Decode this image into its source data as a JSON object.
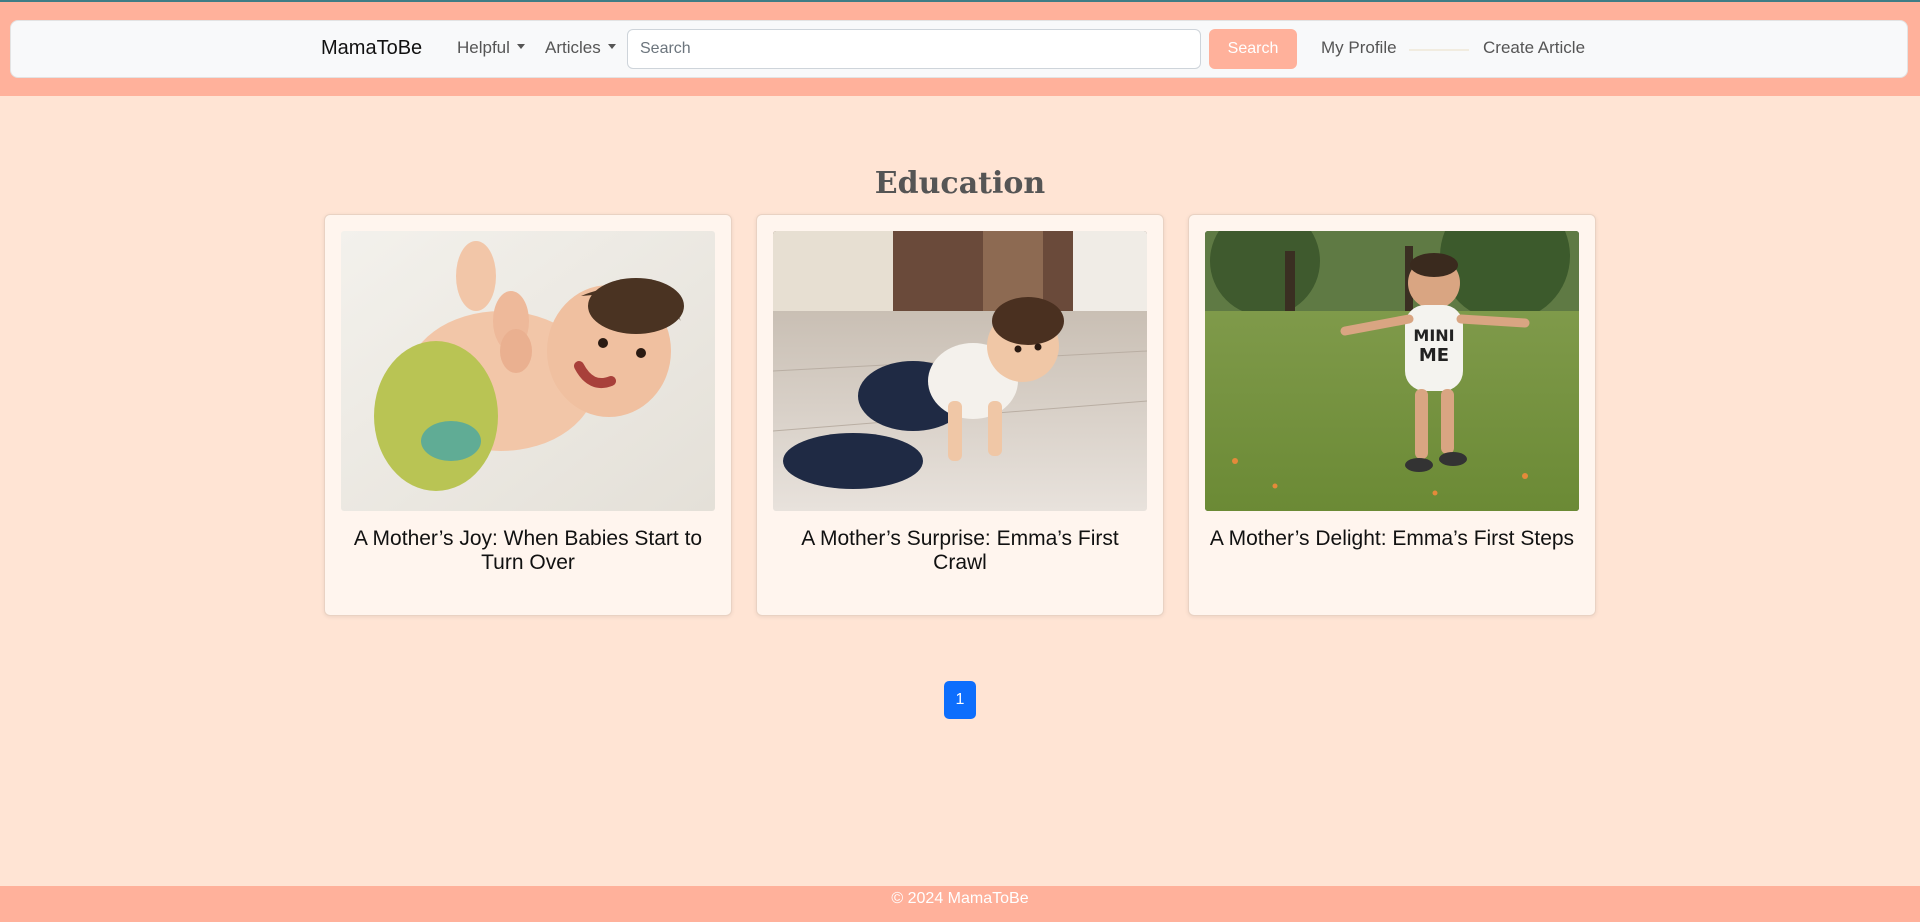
{
  "navbar": {
    "brand": "MamaToBe",
    "helpful_label": "Helpful",
    "articles_label": "Articles",
    "search_placeholder": "Search",
    "search_button": "Search",
    "profile_link": "My Profile",
    "create_link": "Create Article"
  },
  "section": {
    "title": "Education"
  },
  "cards": [
    {
      "title": "A Mother’s Joy: When Babies Start to Turn Over",
      "image": "baby-lying-on-blanket"
    },
    {
      "title": "A Mother’s Surprise: Emma’s First Crawl",
      "image": "baby-crawling-on-floor"
    },
    {
      "title": "A Mother’s Delight: Emma’s First Steps",
      "image": "toddler-walking-in-park"
    }
  ],
  "pagination": {
    "current_page": "1"
  },
  "footer": {
    "text": "© 2024 MamaToBe"
  },
  "colors": {
    "page_background": "#ffe4d4",
    "accent": "#ffb19b",
    "primary": "#0d6efd"
  }
}
